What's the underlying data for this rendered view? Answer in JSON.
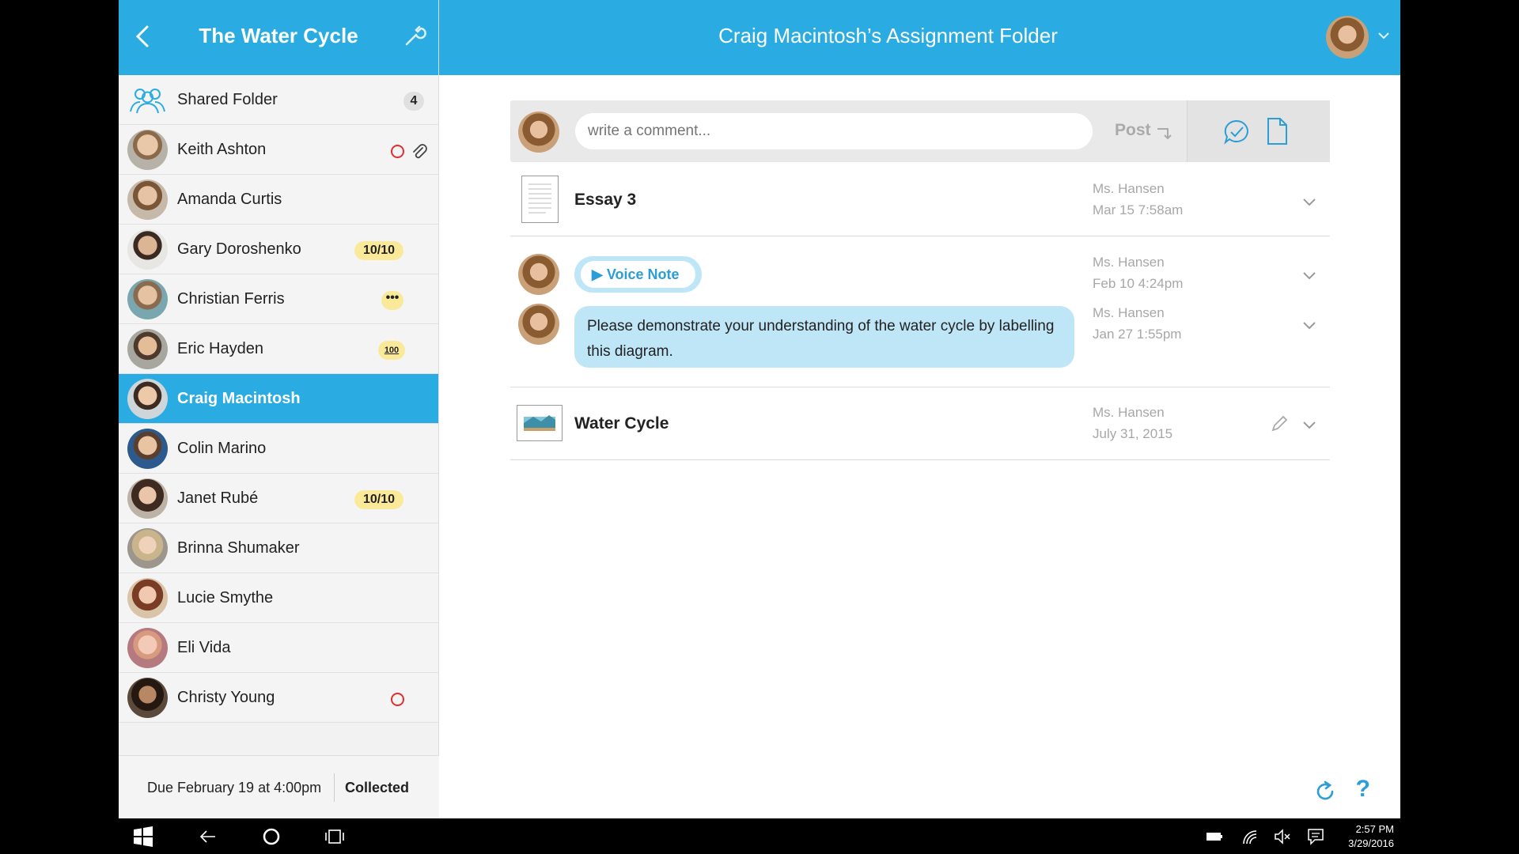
{
  "sidebar": {
    "title": "The Water Cycle",
    "items": [
      {
        "name": "Shared Folder",
        "badge": "4"
      },
      {
        "name": "Keith Ashton"
      },
      {
        "name": "Amanda Curtis"
      },
      {
        "name": "Gary Doroshenko",
        "badge": "10/10"
      },
      {
        "name": "Christian Ferris",
        "badge": "•••"
      },
      {
        "name": "Eric Hayden",
        "badge": "100"
      },
      {
        "name": "Craig Macintosh"
      },
      {
        "name": "Colin Marino"
      },
      {
        "name": "Janet Rubé",
        "badge": "10/10"
      },
      {
        "name": "Brinna Shumaker"
      },
      {
        "name": "Lucie Smythe"
      },
      {
        "name": "Eli Vida"
      },
      {
        "name": "Christy Young"
      }
    ],
    "footer": {
      "due": "Due February 19 at 4:00pm",
      "status": "Collected"
    }
  },
  "header": {
    "title": "Craig Macintosh’s Assignment Folder"
  },
  "composer": {
    "placeholder": "write a comment...",
    "post_label": "Post"
  },
  "feed": {
    "essay": {
      "title": "Essay 3",
      "author": "Ms. Hansen",
      "date": "Mar 15 7:58am"
    },
    "voice_note": {
      "label": "Voice Note",
      "author": "Ms. Hansen",
      "date": "Feb 10 4:24pm"
    },
    "comment": {
      "text": "Please demonstrate your understanding of the water cycle by labelling this diagram.",
      "author": "Ms. Hansen",
      "date": "Jan 27 1:55pm"
    },
    "water": {
      "title": "Water Cycle",
      "author": "Ms. Hansen",
      "date": "July 31, 2015"
    }
  },
  "footer": {
    "help": "?"
  },
  "taskbar": {
    "time": "2:57 PM",
    "date": "3/29/2016"
  },
  "colors": {
    "accent": "#2aace2",
    "bubble": "#bfe6f7",
    "badge_yellow": "#fbe99a",
    "alert_red": "#e02f2f"
  },
  "icons": [
    "back-icon",
    "wrench-icon",
    "group-icon",
    "paperclip-icon",
    "chevron-down-icon",
    "chat-check-icon",
    "document-icon",
    "pencil-icon",
    "refresh-icon",
    "windows-icon"
  ]
}
